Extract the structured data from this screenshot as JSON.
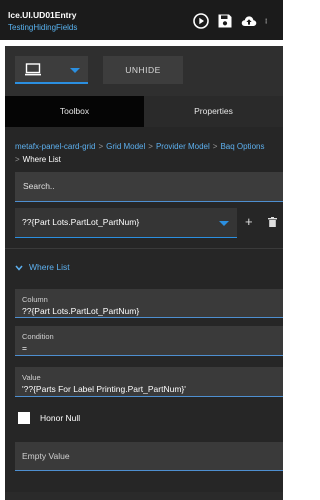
{
  "topbar": {
    "title": "Ice.UI.UD01Entry",
    "subtitle": "TestingHidingFields",
    "icons": [
      "play-icon",
      "save-icon",
      "cloud-upload-icon",
      "more-icon"
    ]
  },
  "toolbar": {
    "device_icon": "monitor-icon",
    "unhide_label": "UNHIDE"
  },
  "tabs": [
    {
      "label": "Toolbox",
      "active": true
    },
    {
      "label": "Properties",
      "active": false
    }
  ],
  "breadcrumb": {
    "items": [
      "metafx-panel-card-grid",
      "Grid Model",
      "Provider Model",
      "Baq Options"
    ],
    "current": "Where List",
    "separator": ">"
  },
  "search": {
    "placeholder": "Search.."
  },
  "where_select": {
    "value": "??{Part Lots.PartLot_PartNum}"
  },
  "section": {
    "title": "Where List"
  },
  "fields": {
    "column": {
      "label": "Column",
      "value": "??{Part Lots.PartLot_PartNum}"
    },
    "condition": {
      "label": "Condition",
      "value": "="
    },
    "value": {
      "label": "Value",
      "value": "'??{Parts For Label Printing.Part_PartNum}'"
    }
  },
  "honor_null": {
    "label": "Honor Null",
    "checked": false
  },
  "empty_value": {
    "placeholder": "Empty Value"
  },
  "colors": {
    "accent": "#2b8fe0",
    "link": "#5db0ef",
    "panel_bg": "#262626",
    "field_bg": "#3a3a3a"
  }
}
